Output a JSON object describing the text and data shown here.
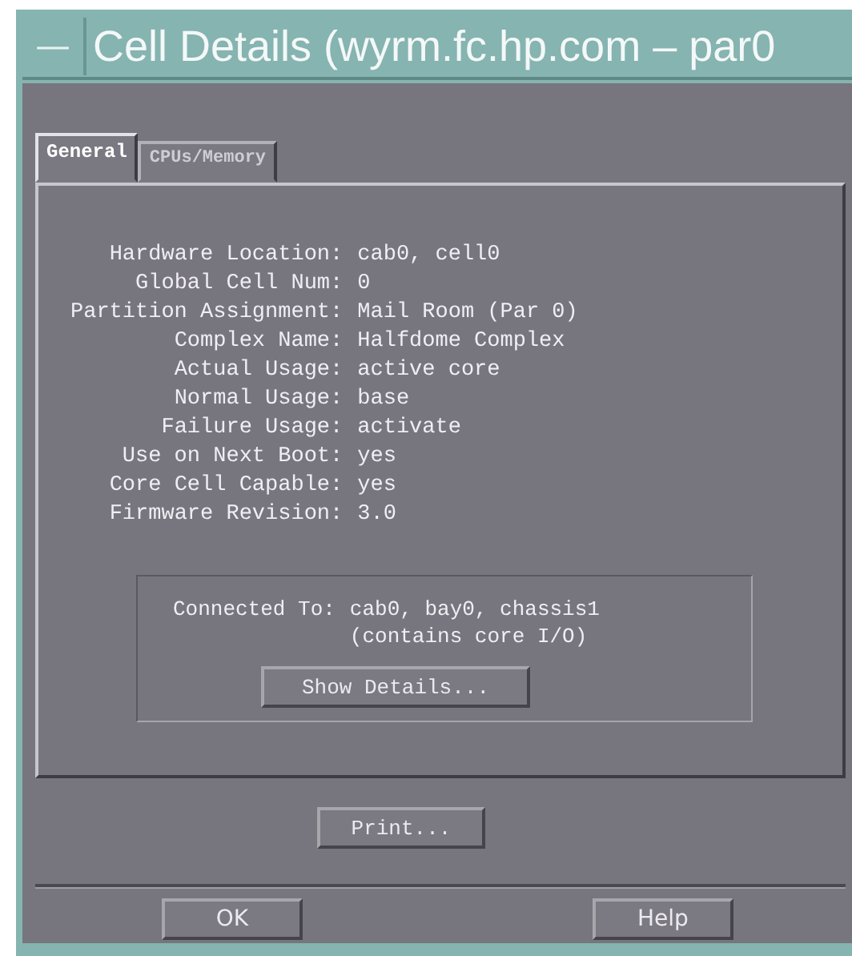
{
  "window": {
    "title": "Cell Details (wyrm.fc.hp.com – par0",
    "menu_button": "—"
  },
  "tabs": [
    {
      "label": "General",
      "selected": true
    },
    {
      "label": "CPUs/Memory",
      "selected": false
    }
  ],
  "fields": [
    {
      "label": "Hardware Location:",
      "value": "cab0, cell0"
    },
    {
      "label": "Global Cell Num:",
      "value": "0"
    },
    {
      "label": "Partition Assignment:",
      "value": "Mail Room (Par 0)"
    },
    {
      "label": "Complex Name:",
      "value": "Halfdome Complex"
    },
    {
      "label": "Actual Usage:",
      "value": "active core"
    },
    {
      "label": "Normal Usage:",
      "value": "base"
    },
    {
      "label": "Failure Usage:",
      "value": "activate"
    },
    {
      "label": "Use on Next Boot:",
      "value": "yes"
    },
    {
      "label": "Core Cell Capable:",
      "value": "yes"
    },
    {
      "label": "Firmware Revision:",
      "value": "3.0"
    }
  ],
  "connection": {
    "label": "Connected To:",
    "value_lines": [
      "cab0, bay0, chassis1",
      "(contains core I/O)"
    ],
    "button": "Show Details..."
  },
  "print_button": "Print...",
  "buttons": [
    "OK",
    "Help"
  ]
}
